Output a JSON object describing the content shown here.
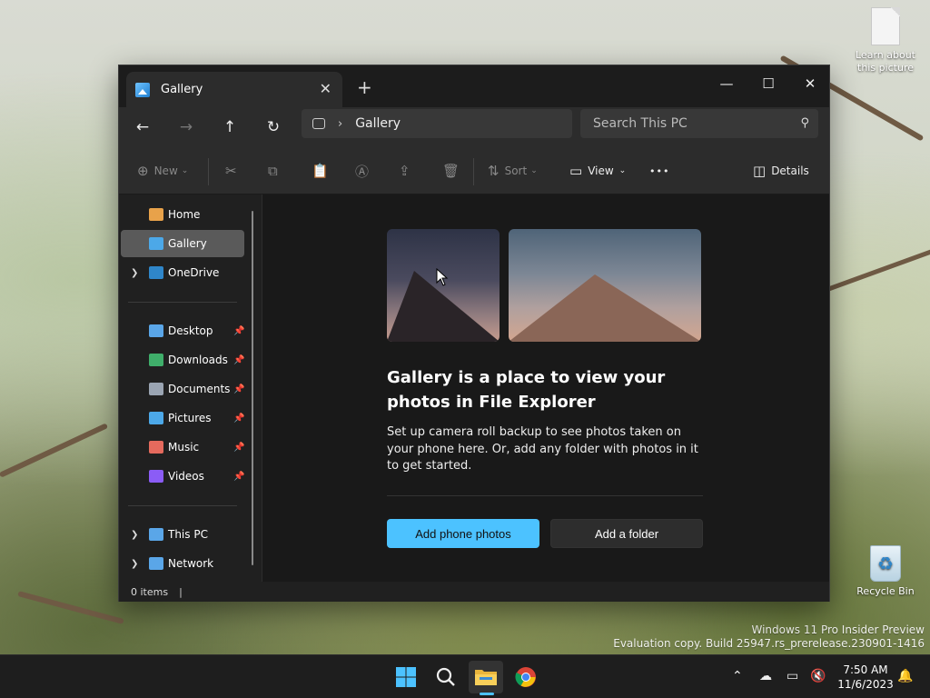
{
  "desktop": {
    "icons": [
      {
        "label": "Learn about this picture"
      },
      {
        "label": "Recycle Bin"
      }
    ],
    "watermark": {
      "line1": "Windows 11 Pro Insider Preview",
      "line2": "Evaluation copy. Build 25947.rs_prerelease.230901-1416"
    }
  },
  "window": {
    "tab": {
      "title": "Gallery",
      "close": "✕"
    },
    "new_tab": "+",
    "controls": {
      "minimize": "—",
      "maximize": "☐",
      "close": "✕"
    },
    "nav": {
      "back": "←",
      "forward": "→",
      "up": "↑",
      "refresh": "↻"
    },
    "address": {
      "location": "Gallery",
      "separator": "›"
    },
    "search": {
      "placeholder": "Search This PC"
    },
    "toolbar": {
      "new_label": "New",
      "sort_label": "Sort",
      "view_label": "View",
      "more_label": "•••",
      "details_label": "Details"
    },
    "sidebar": {
      "top": [
        {
          "label": "Home",
          "color": "#e8a24a"
        },
        {
          "label": "Gallery",
          "color": "#4ca8e8"
        },
        {
          "label": "OneDrive",
          "color": "#2f86c9"
        }
      ],
      "quick": [
        {
          "label": "Desktop",
          "color": "#5aa6e8"
        },
        {
          "label": "Downloads",
          "color": "#3fae6a"
        },
        {
          "label": "Documents",
          "color": "#9aa4b2"
        },
        {
          "label": "Pictures",
          "color": "#4ca8e8"
        },
        {
          "label": "Music",
          "color": "#e56a5d"
        },
        {
          "label": "Videos",
          "color": "#8b5cf6"
        }
      ],
      "bottom": [
        {
          "label": "This PC",
          "color": "#5aa6e8"
        },
        {
          "label": "Network",
          "color": "#5aa6e8"
        }
      ]
    },
    "gallery": {
      "title": "Gallery is a place to view your photos in File Explorer",
      "description": "Set up camera roll backup to see photos taken on your phone here. Or, add any folder with photos in it to get started.",
      "primary_button": "Add phone photos",
      "secondary_button": "Add a folder"
    },
    "status": {
      "items": "0 items",
      "separator": "|"
    }
  },
  "taskbar": {
    "clock": {
      "time": "7:50 AM",
      "date": "11/6/2023"
    },
    "accent": "#4cc2ff"
  }
}
